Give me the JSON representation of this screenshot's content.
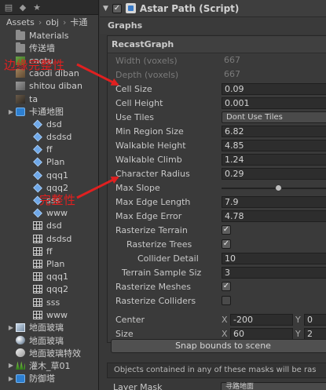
{
  "project": {
    "breadcrumb": [
      "Assets",
      "obj",
      "卡通"
    ],
    "items": [
      {
        "label": "Materials",
        "icon": "folder-icon",
        "indent": 0
      },
      {
        "label": "传送墙",
        "icon": "folder-icon",
        "indent": 0
      },
      {
        "label": "caotu",
        "icon": "texture-icon-green",
        "indent": 0
      },
      {
        "label": "caodi diban",
        "icon": "texture-icon-brown",
        "indent": 0
      },
      {
        "label": "shitou diban",
        "icon": "texture-icon-stone",
        "indent": 0
      },
      {
        "label": "ta",
        "icon": "texture-icon-dark",
        "indent": 0
      },
      {
        "label": "卡通地图",
        "icon": "model-prefab-icon",
        "indent": 0,
        "expandable": true
      },
      {
        "label": "dsd",
        "icon": "prefab-icon",
        "indent": 1
      },
      {
        "label": "dsdsd",
        "icon": "prefab-icon",
        "indent": 1
      },
      {
        "label": "ff",
        "icon": "prefab-icon",
        "indent": 1
      },
      {
        "label": "Plan",
        "icon": "prefab-icon",
        "indent": 1
      },
      {
        "label": "qqq1",
        "icon": "prefab-icon",
        "indent": 1
      },
      {
        "label": "qqq2",
        "icon": "prefab-icon",
        "indent": 1
      },
      {
        "label": "sss",
        "icon": "prefab-icon",
        "indent": 1
      },
      {
        "label": "www",
        "icon": "prefab-icon",
        "indent": 1
      },
      {
        "label": "dsd",
        "icon": "mesh-grid-icon",
        "indent": 1
      },
      {
        "label": "dsdsd",
        "icon": "mesh-grid-icon",
        "indent": 1
      },
      {
        "label": "ff",
        "icon": "mesh-grid-icon",
        "indent": 1
      },
      {
        "label": "Plan",
        "icon": "mesh-grid-icon",
        "indent": 1
      },
      {
        "label": "qqq1",
        "icon": "mesh-grid-icon",
        "indent": 1
      },
      {
        "label": "qqq2",
        "icon": "mesh-grid-icon",
        "indent": 1
      },
      {
        "label": "sss",
        "icon": "mesh-grid-icon",
        "indent": 1
      },
      {
        "label": "www",
        "icon": "mesh-grid-icon",
        "indent": 1
      },
      {
        "label": "地面玻璃",
        "icon": "material-icon",
        "indent": 0,
        "expandable": true
      },
      {
        "label": "地面玻璃",
        "icon": "sphere-material-icon",
        "indent": 0
      },
      {
        "label": "地面玻璃特效",
        "icon": "shader-icon",
        "indent": 0
      },
      {
        "label": "灌木_草01",
        "icon": "grass-icon",
        "indent": 0,
        "expandable": true
      },
      {
        "label": "防御塔",
        "icon": "model-prefab-icon",
        "indent": 0,
        "expandable": true
      }
    ]
  },
  "annotations": {
    "top": "边缘完整性",
    "bottom": "完整性",
    "color": "#e02020"
  },
  "inspector": {
    "component_title": "Astar Path (Script)",
    "graphs_label": "Graphs",
    "graph_name": "RecastGraph",
    "props": [
      {
        "key": "width",
        "label": "Width (voxels)",
        "value": "667",
        "disabled": true,
        "kind": "text"
      },
      {
        "key": "depth",
        "label": "Depth (voxels)",
        "value": "667",
        "disabled": true,
        "kind": "text"
      },
      {
        "key": "cell_size",
        "label": "Cell Size",
        "value": "0.09",
        "kind": "field"
      },
      {
        "key": "cell_height",
        "label": "Cell Height",
        "value": "0.001",
        "kind": "field"
      },
      {
        "key": "use_tiles",
        "label": "Use Tiles",
        "value": "Dont Use Tiles",
        "kind": "dropdown"
      },
      {
        "key": "min_region_size",
        "label": "Min Region Size",
        "value": "6.82",
        "kind": "field"
      },
      {
        "key": "walkable_height",
        "label": "Walkable Height",
        "value": "4.85",
        "kind": "field"
      },
      {
        "key": "walkable_climb",
        "label": "Walkable Climb",
        "value": "1.24",
        "kind": "field"
      },
      {
        "key": "character_radius",
        "label": "Character Radius",
        "value": "0.29",
        "kind": "field"
      },
      {
        "key": "max_slope",
        "label": "Max Slope",
        "value": "",
        "kind": "slider",
        "slider_fraction": 0.5
      },
      {
        "key": "max_edge_length",
        "label": "Max Edge Length",
        "value": "7.9",
        "kind": "field"
      },
      {
        "key": "max_edge_error",
        "label": "Max Edge Error",
        "value": "4.78",
        "kind": "field"
      },
      {
        "key": "rasterize_terrain",
        "label": "Rasterize Terrain",
        "value": "✓",
        "kind": "checkbox",
        "checked": true
      },
      {
        "key": "rasterize_trees",
        "label": "Rasterize Trees",
        "value": "✓",
        "kind": "checkbox",
        "checked": true,
        "indent": 1
      },
      {
        "key": "collider_detail",
        "label": "Collider Detail",
        "value": "10",
        "kind": "field",
        "indent": 2
      },
      {
        "key": "terrain_sample_size",
        "label": "Terrain Sample Siz",
        "value": "3",
        "kind": "field",
        "indent": 3
      },
      {
        "key": "rasterize_meshes",
        "label": "Rasterize Meshes",
        "value": "✓",
        "kind": "checkbox",
        "checked": true
      },
      {
        "key": "rasterize_colliders",
        "label": "Rasterize Colliders",
        "value": "",
        "kind": "checkbox",
        "checked": false
      }
    ],
    "center": {
      "label": "Center",
      "x_axis": "X",
      "x": "-200",
      "y_axis": "Y",
      "y": "0"
    },
    "size": {
      "label": "Size",
      "x_axis": "X",
      "x": "60",
      "y_axis": "Y",
      "y": "2"
    },
    "snap_button": "Snap bounds to scene",
    "mask_note": "Objects contained in any of these masks will be ras",
    "layer_mask": {
      "label": "Layer Mask",
      "value": "寻路地面"
    }
  }
}
